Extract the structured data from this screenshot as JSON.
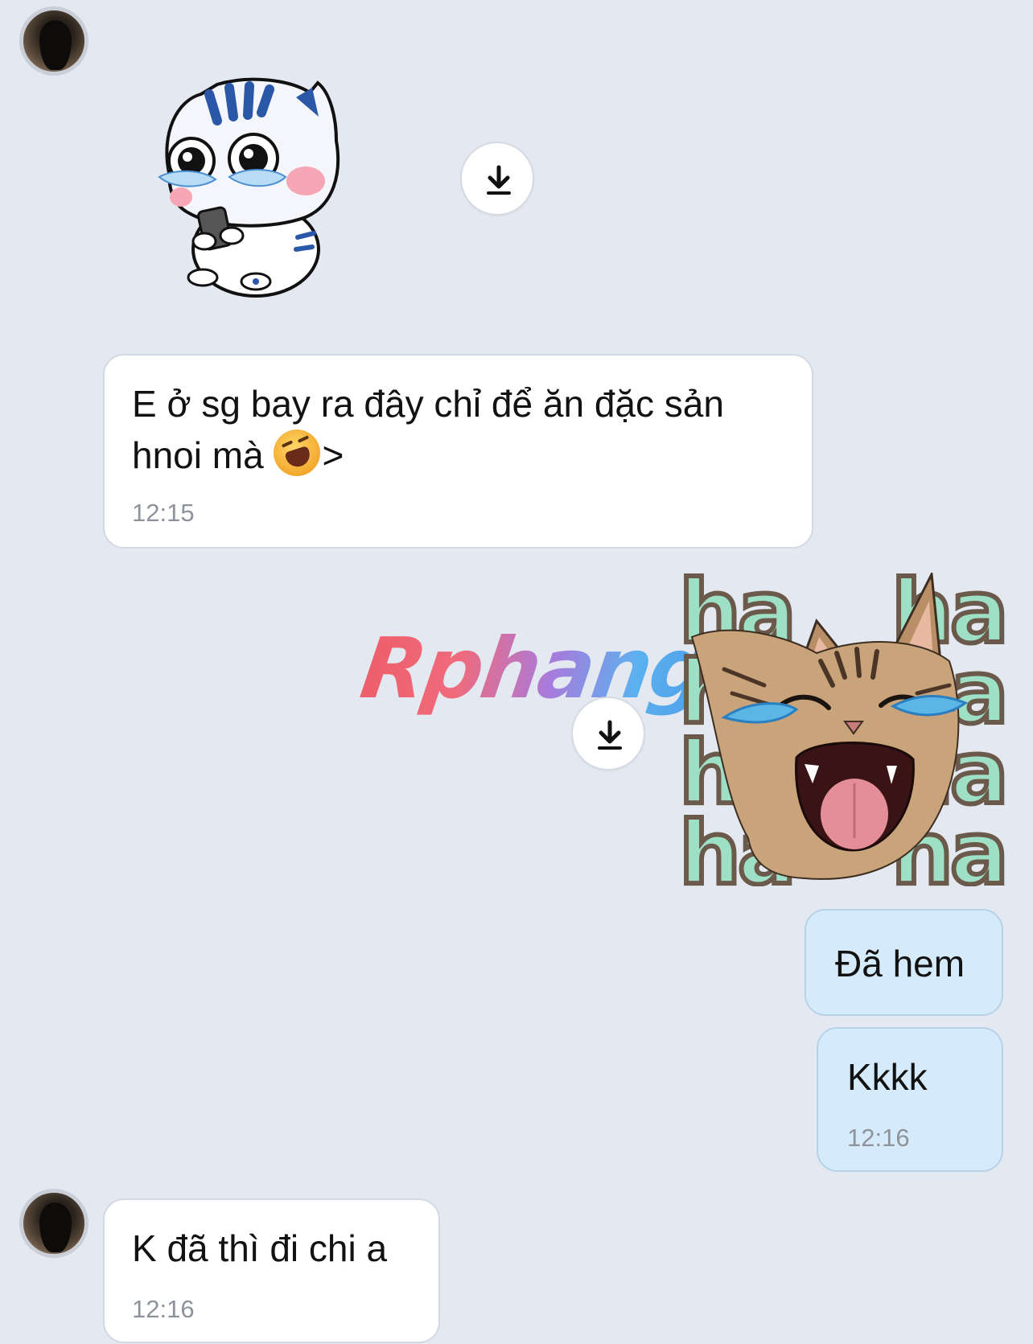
{
  "conversation": {
    "messages": [
      {
        "id": "m1",
        "direction": "incoming",
        "type": "sticker",
        "sticker_name": "crying-cat-phone-sticker"
      },
      {
        "id": "m2",
        "direction": "incoming",
        "type": "text",
        "text_line1": "E ở sg bay ra đây chỉ để ăn đặc sản",
        "text_line2_prefix": "hnoi mà ",
        "emoji_name": "laughing-face-emoji",
        "text_line2_suffix": ">",
        "time": "12:15"
      },
      {
        "id": "m3",
        "direction": "outgoing",
        "type": "sticker",
        "sticker_name": "haha-cat-sticker",
        "sticker_text": [
          "ha",
          "ha",
          "ha",
          "ha",
          "ha",
          "ha",
          "ha",
          "ha"
        ]
      },
      {
        "id": "m4",
        "direction": "outgoing",
        "type": "text",
        "text": "Đã hem"
      },
      {
        "id": "m5",
        "direction": "outgoing",
        "type": "text",
        "text": "Kkkk",
        "time": "12:16"
      },
      {
        "id": "m6",
        "direction": "incoming",
        "type": "text",
        "text": "K đã thì đi chi a",
        "time": "12:16"
      }
    ]
  },
  "watermark": {
    "text": "Rphang"
  },
  "icons": {
    "download": "download-icon",
    "avatar": "contact-avatar"
  },
  "colors": {
    "background": "#e3e8f1",
    "incoming_bubble": "#ffffff",
    "outgoing_bubble": "#d5ebfb",
    "timestamp": "#8e939b"
  }
}
